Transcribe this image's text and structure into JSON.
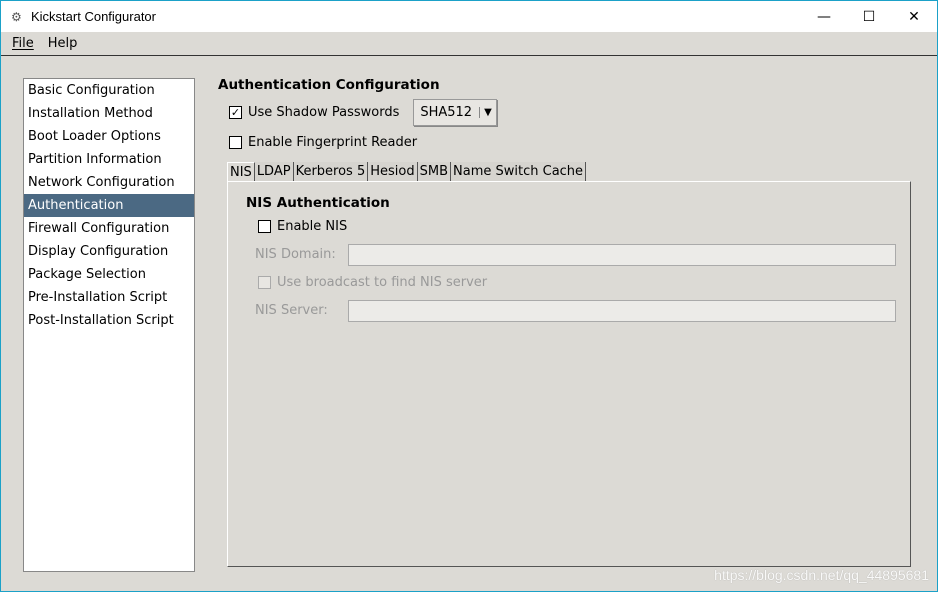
{
  "window": {
    "title": "Kickstart Configurator",
    "minimize": "—",
    "maximize": "☐",
    "close": "✕"
  },
  "menu": {
    "file": "File",
    "help": "Help"
  },
  "sidebar": {
    "selected": "Authentication",
    "items": [
      "Basic Configuration",
      "Installation Method",
      "Boot Loader Options",
      "Partition Information",
      "Network Configuration",
      "Authentication",
      "Firewall Configuration",
      "Display Configuration",
      "Package Selection",
      "Pre-Installation Script",
      "Post-Installation Script"
    ]
  },
  "auth": {
    "heading": "Authentication Configuration",
    "shadow_label": "Use Shadow Passwords",
    "shadow_checked": true,
    "hash_value": "SHA512",
    "fingerprint_label": "Enable Fingerprint Reader",
    "fingerprint_checked": false
  },
  "tabs": {
    "active": "NIS",
    "items": [
      "NIS",
      "LDAP",
      "Kerberos 5",
      "Hesiod",
      "SMB",
      "Name Switch Cache"
    ]
  },
  "nis": {
    "heading": "NIS Authentication",
    "enable_label": "Enable NIS",
    "domain_label": "NIS Domain:",
    "domain_value": "",
    "broadcast_label": "Use broadcast to find NIS server",
    "server_label": "NIS Server:",
    "server_value": ""
  },
  "watermark": "https://blog.csdn.net/qq_44895681"
}
